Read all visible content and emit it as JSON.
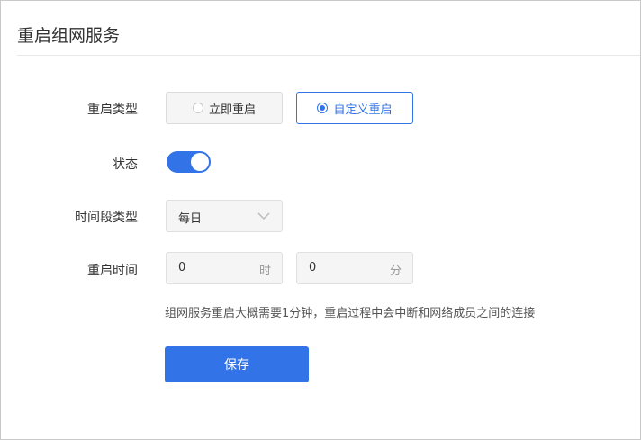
{
  "page": {
    "title": "重启组网服务"
  },
  "form": {
    "restart_type": {
      "label": "重启类型",
      "options": [
        {
          "label": "立即重启",
          "selected": false
        },
        {
          "label": "自定义重启",
          "selected": true
        }
      ]
    },
    "status": {
      "label": "状态",
      "enabled": true
    },
    "period_type": {
      "label": "时间段类型",
      "value": "每日",
      "icon": "chevron-down-icon"
    },
    "restart_time": {
      "label": "重启时间",
      "hour": {
        "value": "0",
        "unit": "时"
      },
      "minute": {
        "value": "0",
        "unit": "分"
      }
    },
    "hint": "组网服务重启大概需要1分钟，重启过程中会中断和网络成员之间的连接",
    "save_label": "保存"
  },
  "colors": {
    "accent": "#3273e8",
    "border": "#dcdcdc",
    "field_bg": "#f5f5f5"
  }
}
